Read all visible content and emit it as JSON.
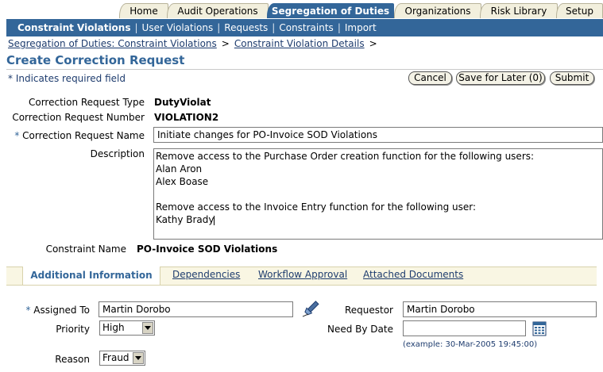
{
  "global_tabs": [
    {
      "label": "Home",
      "active": false
    },
    {
      "label": "Audit Operations",
      "active": false
    },
    {
      "label": "Segregation of Duties",
      "active": true
    },
    {
      "label": "Organizations",
      "active": false
    },
    {
      "label": "Risk Library",
      "active": false
    },
    {
      "label": "Setup",
      "active": false
    }
  ],
  "sub_nav": [
    {
      "label": "Constraint Violations",
      "selected": true
    },
    {
      "label": "User Violations",
      "selected": false
    },
    {
      "label": "Requests",
      "selected": false
    },
    {
      "label": "Constraints",
      "selected": false
    },
    {
      "label": "Import",
      "selected": false
    }
  ],
  "breadcrumb": {
    "items": [
      "Segregation of Duties: Constraint Violations",
      "Constraint Violation Details"
    ],
    "separator": ">"
  },
  "page": {
    "title": "Create Correction Request",
    "required_note": "* Indicates required field"
  },
  "buttons": {
    "cancel": "Cancel",
    "save_for_later": "Save for Later (0)",
    "submit": "Submit"
  },
  "form": {
    "request_type_label": "Correction Request Type",
    "request_type_value": "DutyViolat",
    "request_number_label": "Correction Request Number",
    "request_number_value": "VIOLATION2",
    "request_name_label": "Correction Request Name",
    "request_name_value": "Initiate changes for PO-Invoice SOD Violations",
    "description_label": "Description",
    "description_lines": [
      "Remove access to the Purchase Order creation function for the following users:",
      "Alan Aron",
      "Alex Boase",
      "",
      "Remove access to the Invoice Entry function for the following user:",
      "Kathy Brady"
    ],
    "constraint_name_label": "Constraint Name",
    "constraint_name_value": "PO-Invoice SOD Violations"
  },
  "sub_tabs": [
    {
      "label": "Additional Information",
      "active": true
    },
    {
      "label": "Dependencies",
      "active": false
    },
    {
      "label": "Workflow Approval",
      "active": false
    },
    {
      "label": "Attached Documents",
      "active": false
    }
  ],
  "additional": {
    "assigned_to_label": "Assigned To",
    "assigned_to_value": "Martin Dorobo",
    "requestor_label": "Requestor",
    "requestor_value": "Martin Dorobo",
    "priority_label": "Priority",
    "priority_value": "High",
    "need_by_label": "Need By Date",
    "need_by_value": "",
    "need_by_hint": "(example: 30-Mar-2005 19:45:00)",
    "reason_label": "Reason",
    "reason_value": "Fraud"
  },
  "colors": {
    "brand_blue": "#336699",
    "tab_beige": "#f2efdd",
    "link_blue": "#1e3c6e"
  },
  "icons": {
    "search": "flashlight-search-icon",
    "calendar": "calendar-icon"
  }
}
